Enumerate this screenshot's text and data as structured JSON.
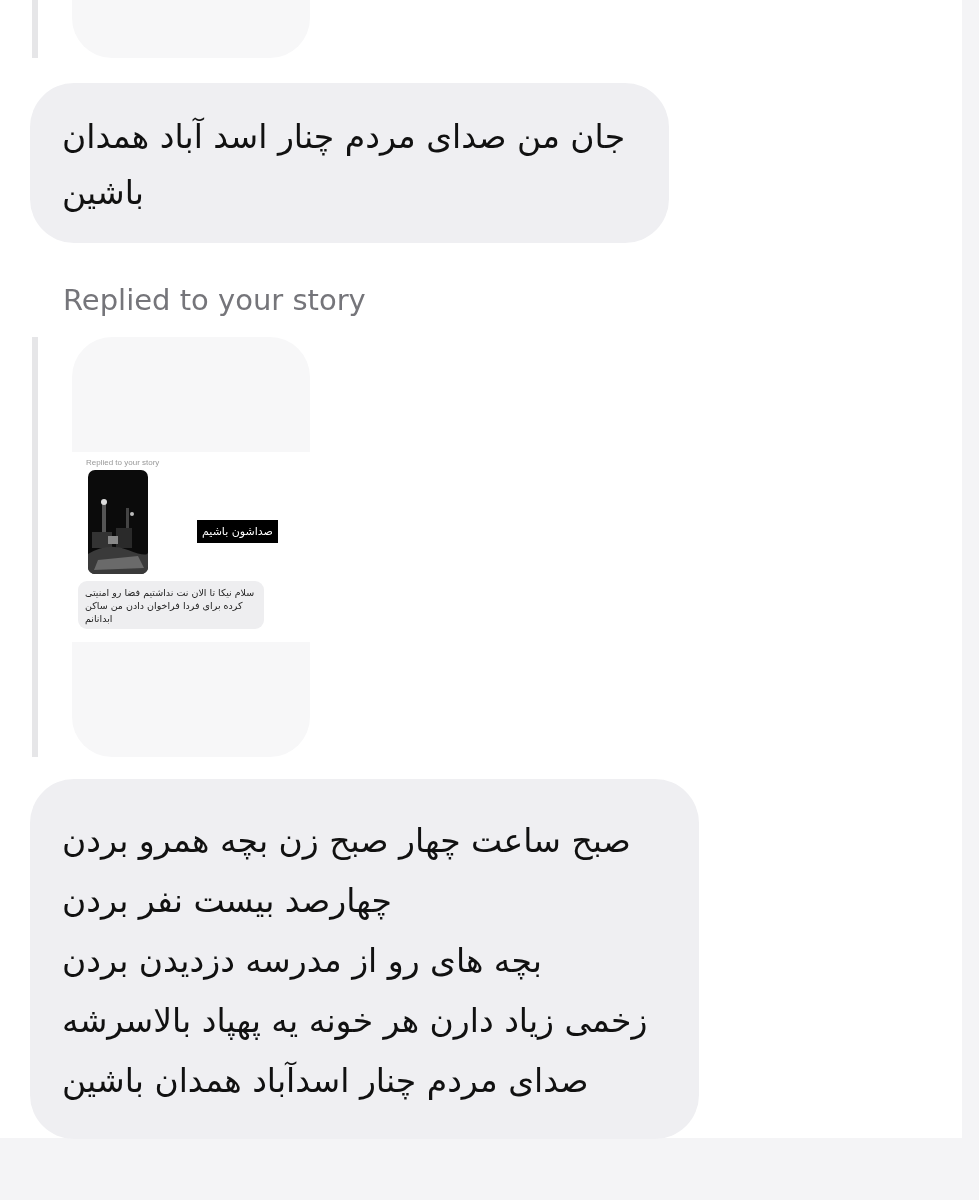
{
  "messages": [
    {
      "kind": "story_reply"
    },
    {
      "kind": "text",
      "lines": [
        "جان من صدای مردم چنار اسد آباد همدان",
        "باشین"
      ]
    },
    {
      "kind": "story_reply",
      "label": "Replied to your story",
      "story": {
        "label": "Replied to your story",
        "thumbnail": {
          "kind": "picture"
        },
        "sticker": "صداشون باشیم",
        "reply_lines": [
          "سلام نیکا  تا الان نت نداشتیم فضا رو امنیتی",
          "کرده برای فردا فراخوان دادن من ساکن",
          "ابدانانم"
        ]
      }
    },
    {
      "kind": "text",
      "lines": [
        "صبح ساعت چهار صبح زن بچه همرو بردن",
        "چهارصد بیست نفر بردن",
        "بچه های رو از مدرسه دزدیدن بردن",
        "زخمی زیاد دارن هر خونه یه پهپاد بالاسرشه",
        "صدای مردم چنار اسدآباد همدان باشین"
      ]
    }
  ]
}
